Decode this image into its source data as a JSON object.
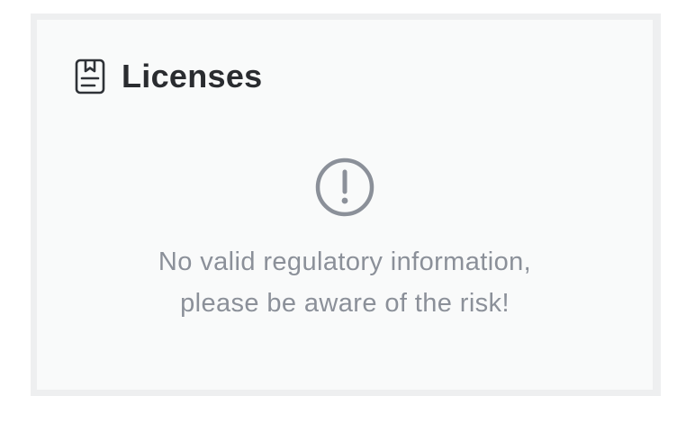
{
  "licenses_card": {
    "title": "Licenses",
    "header_icon": "license-document-icon",
    "empty_state": {
      "icon": "exclamation-circle-icon",
      "message_line1": "No valid regulatory information,",
      "message_line2": "please be aware of the risk!"
    },
    "colors": {
      "outer_border": "#eeeff0",
      "card_background": "#f9fafa",
      "title_text": "#2a2c30",
      "muted_text": "#8b9099",
      "icon_gray": "#8b9099"
    }
  }
}
